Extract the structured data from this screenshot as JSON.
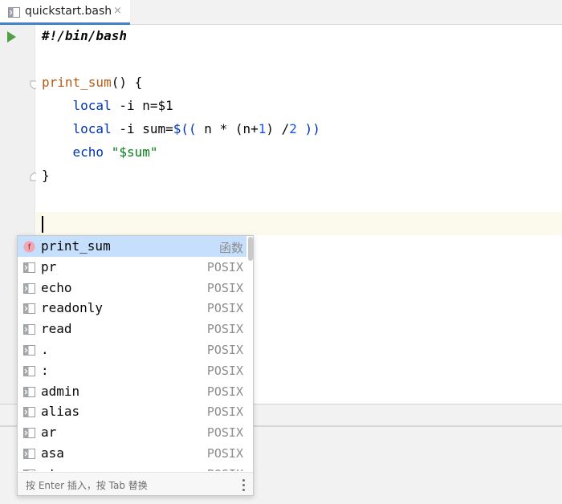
{
  "tab": {
    "filename": "quickstart.bash",
    "icon": "shell-file-icon",
    "close_glyph": "×"
  },
  "editor": {
    "lines": [
      {
        "parts": [
          {
            "t": "#!/bin/bash",
            "c": "shebang"
          }
        ]
      },
      {
        "parts": []
      },
      {
        "parts": [
          {
            "t": "print_sum",
            "c": "fn"
          },
          {
            "t": "() {",
            "c": ""
          }
        ]
      },
      {
        "parts": [
          {
            "t": "    ",
            "c": ""
          },
          {
            "t": "local",
            "c": "kw"
          },
          {
            "t": " -i n=$1",
            "c": ""
          }
        ]
      },
      {
        "parts": [
          {
            "t": "    ",
            "c": ""
          },
          {
            "t": "local",
            "c": "kw"
          },
          {
            "t": " -i sum=",
            "c": ""
          },
          {
            "t": "$((",
            "c": "kw"
          },
          {
            "t": " n * (n+",
            "c": ""
          },
          {
            "t": "1",
            "c": "num"
          },
          {
            "t": ") /",
            "c": ""
          },
          {
            "t": "2",
            "c": "num"
          },
          {
            "t": " ))",
            "c": "kw"
          }
        ]
      },
      {
        "parts": [
          {
            "t": "    ",
            "c": ""
          },
          {
            "t": "echo",
            "c": "kw"
          },
          {
            "t": " ",
            "c": ""
          },
          {
            "t": "\"$sum\"",
            "c": "str"
          }
        ]
      },
      {
        "parts": [
          {
            "t": "}",
            "c": ""
          }
        ]
      }
    ]
  },
  "completion": {
    "items": [
      {
        "label": "print_sum",
        "type": "函数",
        "icon": "function-icon",
        "selected": true
      },
      {
        "label": "pr",
        "type": "POSIX",
        "icon": "shell-command-icon"
      },
      {
        "label": "echo",
        "type": "POSIX",
        "icon": "shell-command-icon"
      },
      {
        "label": "readonly",
        "type": "POSIX",
        "icon": "shell-command-icon"
      },
      {
        "label": "read",
        "type": "POSIX",
        "icon": "shell-command-icon"
      },
      {
        "label": ".",
        "type": "POSIX",
        "icon": "shell-command-icon"
      },
      {
        "label": ":",
        "type": "POSIX",
        "icon": "shell-command-icon"
      },
      {
        "label": "admin",
        "type": "POSIX",
        "icon": "shell-command-icon"
      },
      {
        "label": "alias",
        "type": "POSIX",
        "icon": "shell-command-icon"
      },
      {
        "label": "ar",
        "type": "POSIX",
        "icon": "shell-command-icon"
      },
      {
        "label": "asa",
        "type": "POSIX",
        "icon": "shell-command-icon"
      },
      {
        "label": "at",
        "type": "POSIX",
        "icon": "shell-command-icon"
      }
    ],
    "footer_hint": "按 Enter 插入，按 Tab 替换"
  },
  "colors": {
    "accent": "#4083c9",
    "selection": "#c5dffc",
    "keyword": "#0033b3",
    "function": "#b35b13",
    "number": "#1750eb",
    "string": "#067d17",
    "run": "#4fa044"
  }
}
